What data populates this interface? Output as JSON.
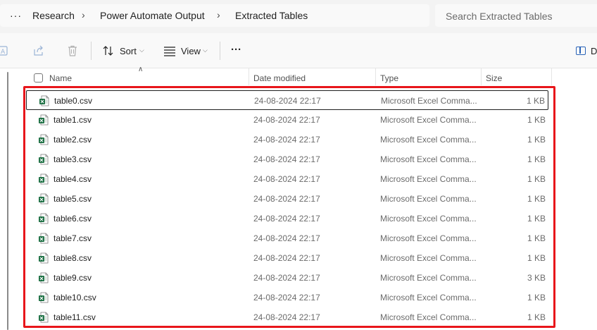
{
  "breadcrumb": {
    "overflow": "···",
    "items": [
      "Research",
      "Power Automate Output",
      "Extracted Tables"
    ],
    "separator": "›"
  },
  "search": {
    "placeholder": "Search Extracted Tables"
  },
  "toolbar": {
    "sort_label": "Sort",
    "view_label": "View",
    "more_label": "···",
    "details_label": "D"
  },
  "columns": {
    "name": "Name",
    "date": "Date modified",
    "type": "Type",
    "size": "Size"
  },
  "files": [
    {
      "name": "table0.csv",
      "date": "24-08-2024 22:17",
      "type": "Microsoft Excel Comma...",
      "size": "1 KB",
      "selected": true
    },
    {
      "name": "table1.csv",
      "date": "24-08-2024 22:17",
      "type": "Microsoft Excel Comma...",
      "size": "1 KB"
    },
    {
      "name": "table2.csv",
      "date": "24-08-2024 22:17",
      "type": "Microsoft Excel Comma...",
      "size": "1 KB"
    },
    {
      "name": "table3.csv",
      "date": "24-08-2024 22:17",
      "type": "Microsoft Excel Comma...",
      "size": "1 KB"
    },
    {
      "name": "table4.csv",
      "date": "24-08-2024 22:17",
      "type": "Microsoft Excel Comma...",
      "size": "1 KB"
    },
    {
      "name": "table5.csv",
      "date": "24-08-2024 22:17",
      "type": "Microsoft Excel Comma...",
      "size": "1 KB"
    },
    {
      "name": "table6.csv",
      "date": "24-08-2024 22:17",
      "type": "Microsoft Excel Comma...",
      "size": "1 KB"
    },
    {
      "name": "table7.csv",
      "date": "24-08-2024 22:17",
      "type": "Microsoft Excel Comma...",
      "size": "1 KB"
    },
    {
      "name": "table8.csv",
      "date": "24-08-2024 22:17",
      "type": "Microsoft Excel Comma...",
      "size": "1 KB"
    },
    {
      "name": "table9.csv",
      "date": "24-08-2024 22:17",
      "type": "Microsoft Excel Comma...",
      "size": "3 KB"
    },
    {
      "name": "table10.csv",
      "date": "24-08-2024 22:17",
      "type": "Microsoft Excel Comma...",
      "size": "1 KB"
    },
    {
      "name": "table11.csv",
      "date": "24-08-2024 22:17",
      "type": "Microsoft Excel Comma...",
      "size": "1 KB"
    }
  ],
  "colors": {
    "highlight": "#e8161b",
    "excel_green": "#1d7044",
    "accent": "#2a63b8"
  }
}
